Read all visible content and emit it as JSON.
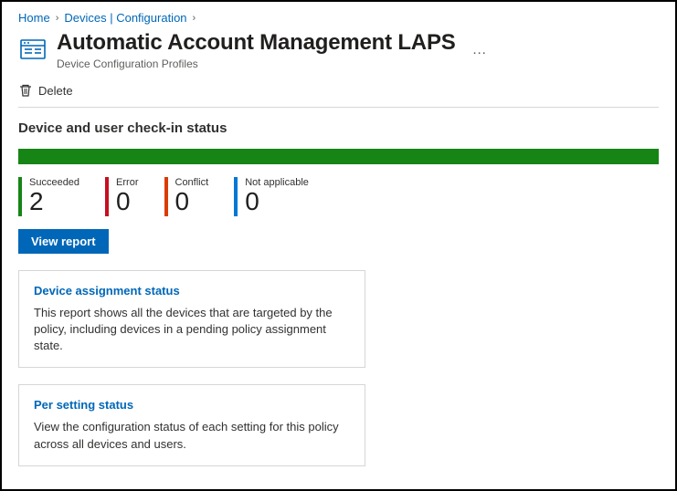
{
  "breadcrumb": {
    "items": [
      "Home",
      "Devices | Configuration"
    ]
  },
  "page": {
    "title": "Automatic Account Management LAPS",
    "subtitle": "Device Configuration Profiles"
  },
  "toolbar": {
    "delete_label": "Delete"
  },
  "section": {
    "status_title": "Device and user check-in status"
  },
  "stats": {
    "succeeded": {
      "label": "Succeeded",
      "value": "2",
      "color": "#168516"
    },
    "error": {
      "label": "Error",
      "value": "0",
      "color": "#c50f1f"
    },
    "conflict": {
      "label": "Conflict",
      "value": "0",
      "color": "#da3b01"
    },
    "not_applicable": {
      "label": "Not applicable",
      "value": "0",
      "color": "#0078d4"
    }
  },
  "buttons": {
    "view_report": "View report"
  },
  "cards": {
    "device_assignment": {
      "title": "Device assignment status",
      "description": "This report shows all the devices that are targeted by the policy, including devices in a pending policy assignment state."
    },
    "per_setting": {
      "title": "Per setting status",
      "description": "View the configuration status of each setting for this policy across all devices and users."
    }
  }
}
